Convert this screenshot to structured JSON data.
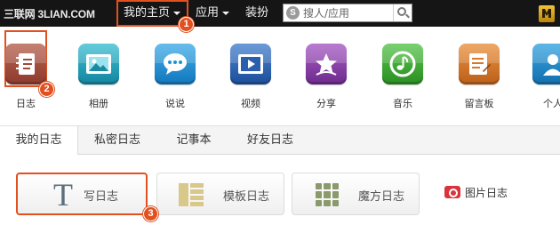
{
  "topbar": {
    "logo_text": "三联网 3LIAN.COM",
    "menu": [
      {
        "label": "我的主页"
      },
      {
        "label": "应用"
      },
      {
        "label": "装扮"
      }
    ],
    "search": {
      "placeholder": "搜人/应用"
    }
  },
  "badges": [
    "1",
    "2",
    "3"
  ],
  "apps": [
    {
      "label": "日志",
      "icon": "notebook-icon",
      "color": "#a04a3a"
    },
    {
      "label": "相册",
      "icon": "photo-album-icon",
      "color": "#1f9fb5"
    },
    {
      "label": "说说",
      "icon": "speech-bubble-icon",
      "color": "#1a93d6"
    },
    {
      "label": "视频",
      "icon": "video-icon",
      "color": "#2a5fae"
    },
    {
      "label": "分享",
      "icon": "share-star-icon",
      "color": "#8a3fa8"
    },
    {
      "label": "音乐",
      "icon": "music-note-icon",
      "color": "#3caa32"
    },
    {
      "label": "留言板",
      "icon": "message-board-icon",
      "color": "#d7782a"
    },
    {
      "label": "个人",
      "icon": "person-icon",
      "color": "#1f8fd0"
    }
  ],
  "tabs": [
    {
      "label": "我的日志"
    },
    {
      "label": "私密日志"
    },
    {
      "label": "记事本"
    },
    {
      "label": "好友日志"
    }
  ],
  "actions": {
    "write": "写日志",
    "template": "模板日志",
    "cube": "魔方日志",
    "photo": "图片日志"
  }
}
